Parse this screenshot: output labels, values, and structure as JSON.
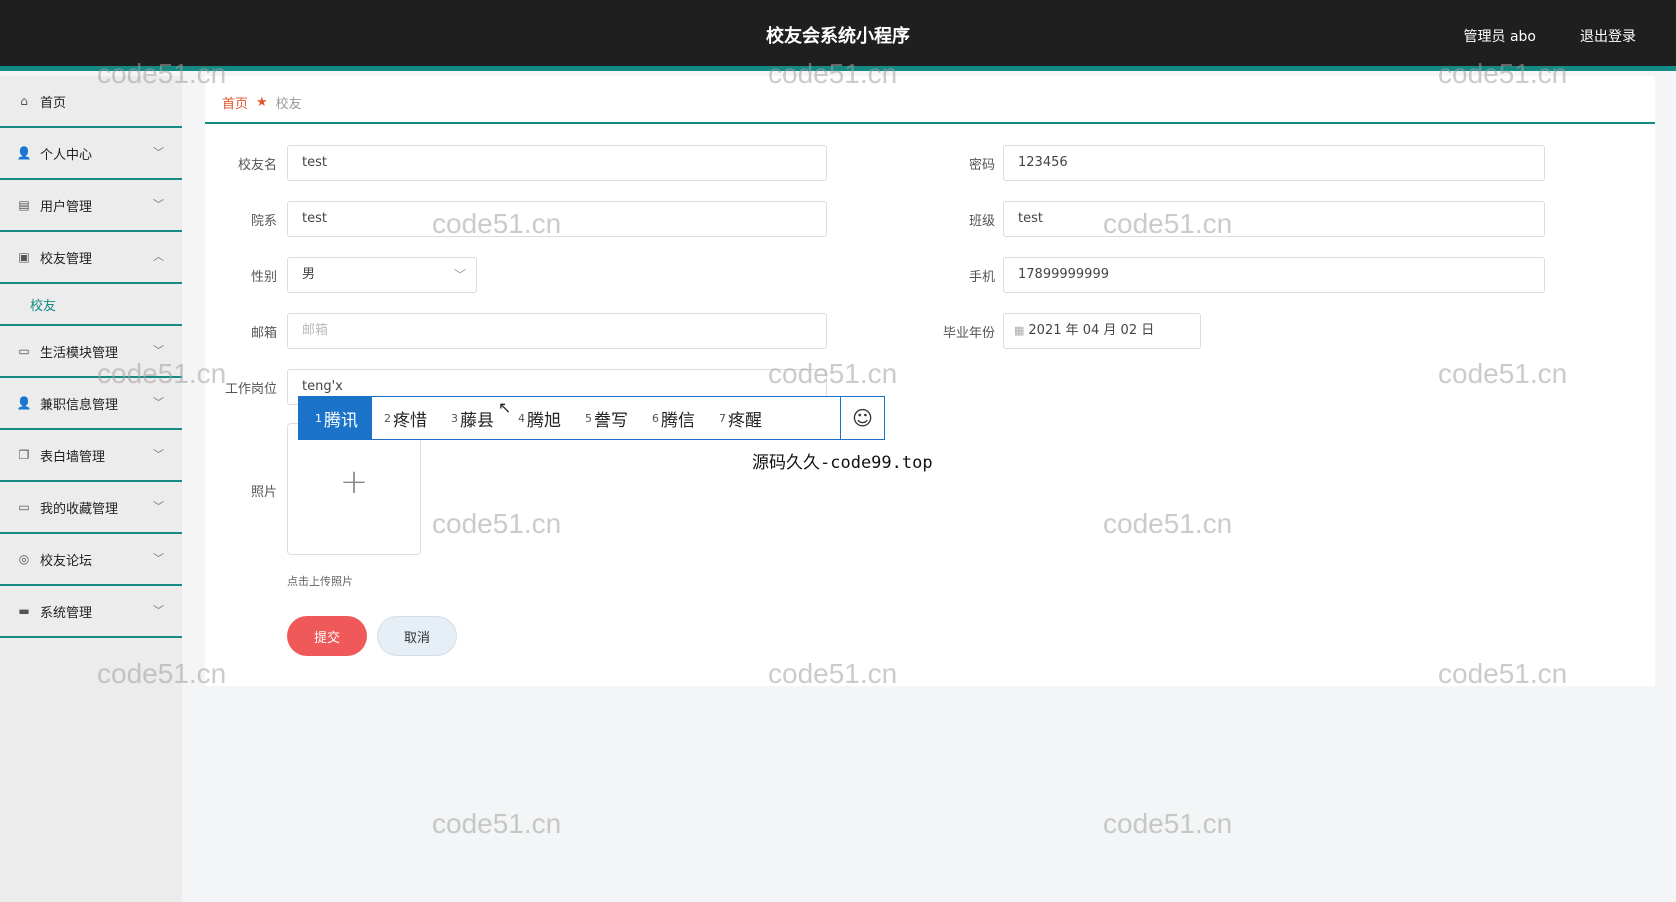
{
  "header": {
    "title": "校友会系统小程序",
    "user": "管理员 abo",
    "logout": "退出登录"
  },
  "sidebar": {
    "items": [
      {
        "label": "首页",
        "icon": "⌂"
      },
      {
        "label": "个人中心",
        "icon": "👤"
      },
      {
        "label": "用户管理",
        "icon": "▤"
      },
      {
        "label": "校友管理",
        "icon": "▣"
      },
      {
        "label": "生活模块管理",
        "icon": "▭"
      },
      {
        "label": "兼职信息管理",
        "icon": "👤"
      },
      {
        "label": "表白墙管理",
        "icon": "❐"
      },
      {
        "label": "我的收藏管理",
        "icon": "▭"
      },
      {
        "label": "校友论坛",
        "icon": "◎"
      },
      {
        "label": "系统管理",
        "icon": "▬"
      }
    ],
    "subitem": "校友",
    "chevron_down": "﹀",
    "chevron_up": "︿"
  },
  "breadcrumb": {
    "home": "首页",
    "star": "★",
    "current": "校友"
  },
  "form": {
    "name_label": "校友名",
    "name_value": "test",
    "password_label": "密码",
    "password_value": "123456",
    "dept_label": "院系",
    "dept_value": "test",
    "class_label": "班级",
    "class_value": "test",
    "gender_label": "性别",
    "gender_value": "男",
    "phone_label": "手机",
    "phone_value": "17899999999",
    "email_label": "邮箱",
    "email_placeholder": "邮箱",
    "grad_label": "毕业年份",
    "grad_value": "2021 年 04 月 02 日",
    "job_label": "工作岗位",
    "job_value": "teng'x",
    "photo_label": "照片",
    "upload_hint": "点击上传照片",
    "submit": "提交",
    "cancel": "取消"
  },
  "ime": {
    "candidates": [
      {
        "n": "1",
        "text": "腾讯"
      },
      {
        "n": "2",
        "text": "疼惜"
      },
      {
        "n": "3",
        "text": "藤县"
      },
      {
        "n": "4",
        "text": "腾旭"
      },
      {
        "n": "5",
        "text": "誊写"
      },
      {
        "n": "6",
        "text": "腾信"
      },
      {
        "n": "7",
        "text": "疼醒"
      }
    ],
    "emoji": "☺",
    "note": "源码久久-code99.top"
  },
  "watermark": "code51.cn"
}
